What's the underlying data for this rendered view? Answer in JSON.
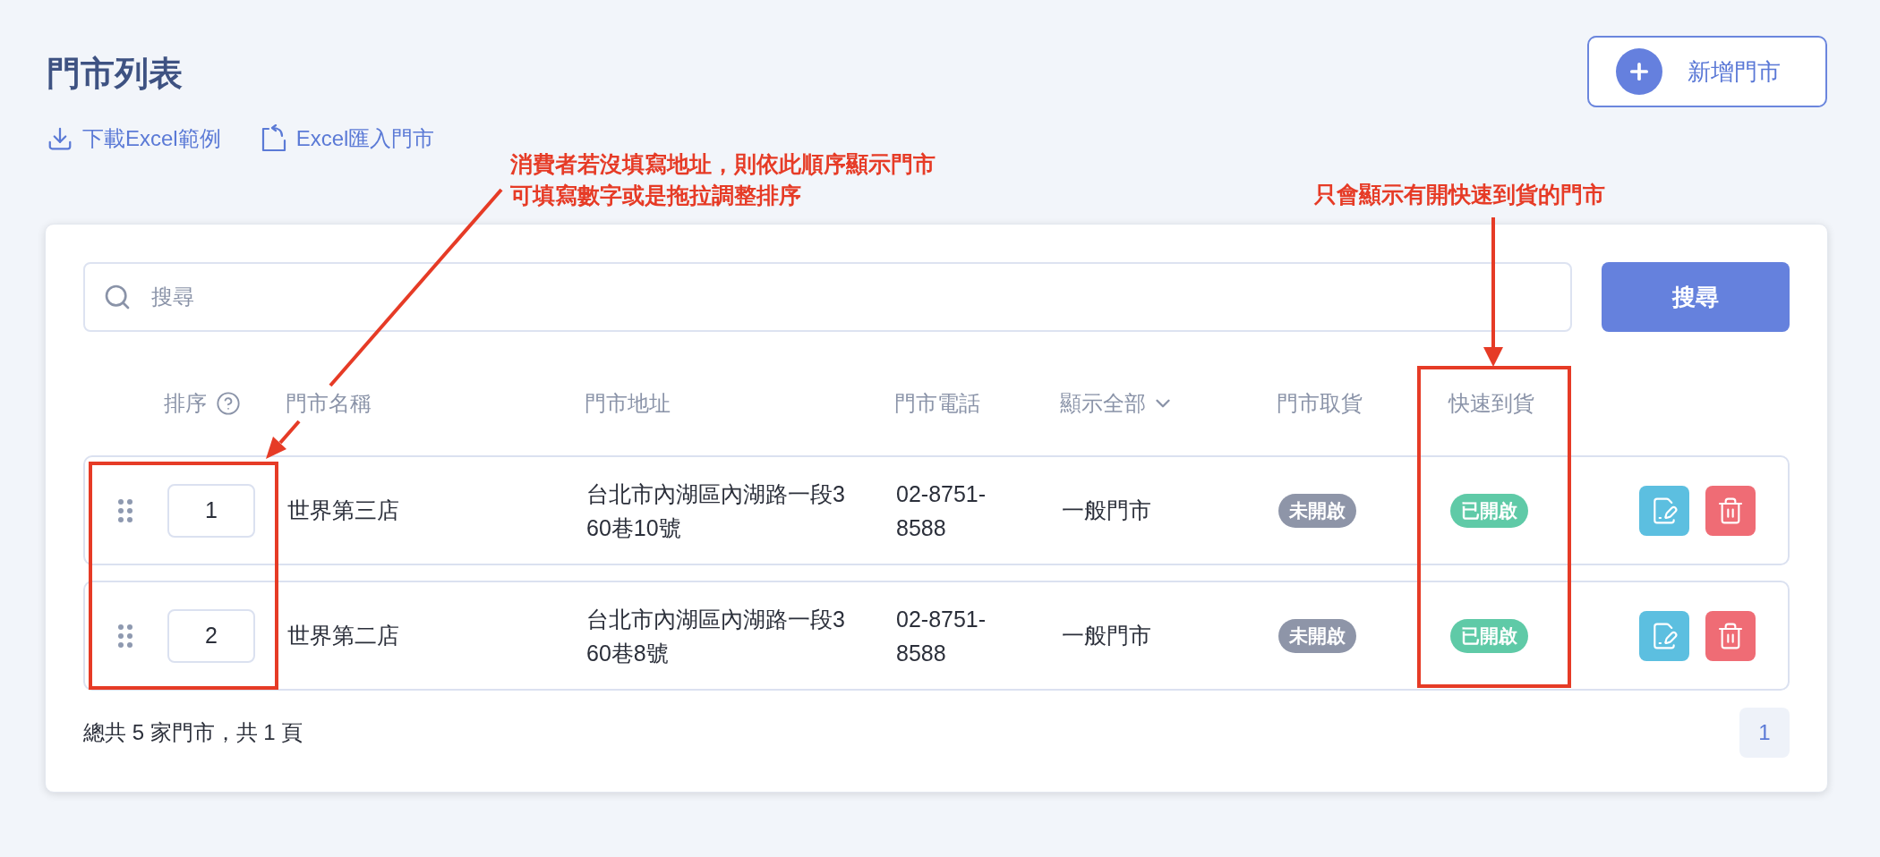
{
  "page_title": "門市列表",
  "add_button": {
    "label": "新增門市"
  },
  "links": [
    {
      "label": "下載Excel範例",
      "kind": "download"
    },
    {
      "label": "Excel匯入門市",
      "kind": "import"
    }
  ],
  "search": {
    "placeholder": "搜尋",
    "button": "搜尋"
  },
  "table": {
    "columns": [
      {
        "label": "排序",
        "kind": "help"
      },
      {
        "label": "門市名稱",
        "kind": "text"
      },
      {
        "label": "門市地址",
        "kind": "text"
      },
      {
        "label": "門市電話",
        "kind": "text"
      },
      {
        "label": "顯示全部",
        "kind": "dropdown"
      },
      {
        "label": "門市取貨",
        "kind": "text"
      },
      {
        "label": "快速到貨",
        "kind": "text"
      }
    ],
    "rows": [
      {
        "order": "1",
        "name": "世界第三店",
        "address": "台北市內湖區內湖路一段360巷10號",
        "phone": "02-8751-8588",
        "type": "一般門市",
        "store_pickup": {
          "label": "未開啟",
          "on": false
        },
        "fast_delivery": {
          "label": "已開啟",
          "on": true
        }
      },
      {
        "order": "2",
        "name": "世界第二店",
        "address": "台北市內湖區內湖路一段360巷8號",
        "phone": "02-8751-8588",
        "type": "一般門市",
        "store_pickup": {
          "label": "未開啟",
          "on": false
        },
        "fast_delivery": {
          "label": "已開啟",
          "on": true
        }
      }
    ]
  },
  "footer": {
    "summary": "總共 5 家門市，共 1 頁",
    "pages": [
      {
        "label": "1",
        "selected": true
      }
    ]
  },
  "annotations": [
    {
      "lines": [
        "消費者若沒填寫地址，則依此順序顯示門市",
        "可填寫數字或是拖拉調整排序"
      ]
    },
    {
      "lines": [
        "只會顯示有開快速到貨的門市"
      ]
    }
  ]
}
